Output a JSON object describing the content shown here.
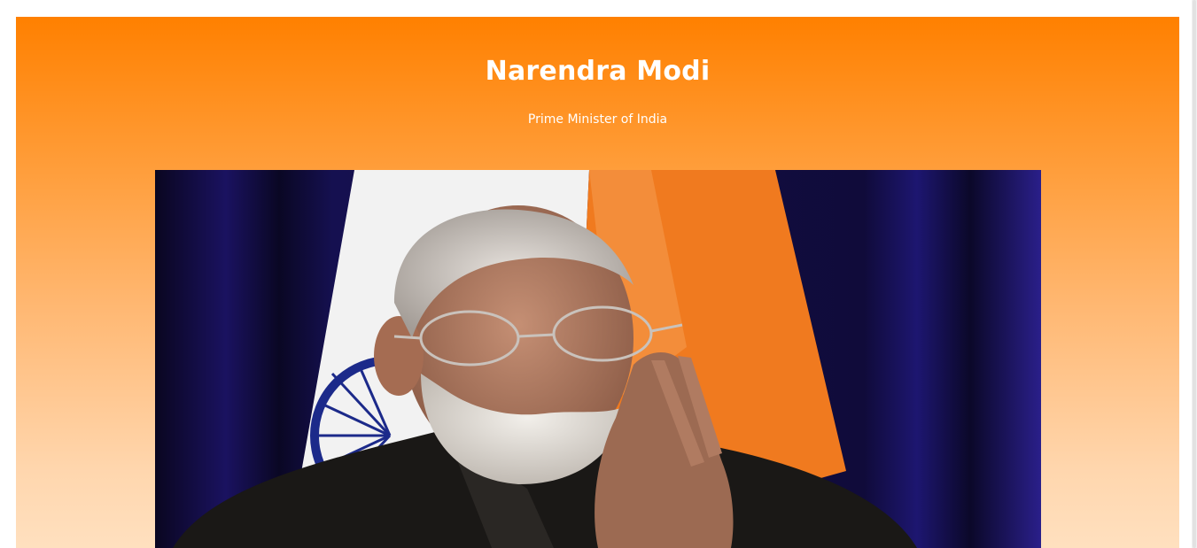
{
  "header": {
    "title": "Narendra Modi",
    "subtitle": "Prime Minister of India"
  },
  "photo": {
    "subject": "portrait-photo",
    "colors": {
      "backdrop": "#0b0829",
      "flag_saffron": "#f07a1f",
      "flag_white": "#f2f2f2",
      "chakra": "#1c2a8a"
    }
  },
  "theme": {
    "accent": "#ff8000",
    "gradient_end": "#ffe0bf",
    "text": "#ffffff"
  }
}
